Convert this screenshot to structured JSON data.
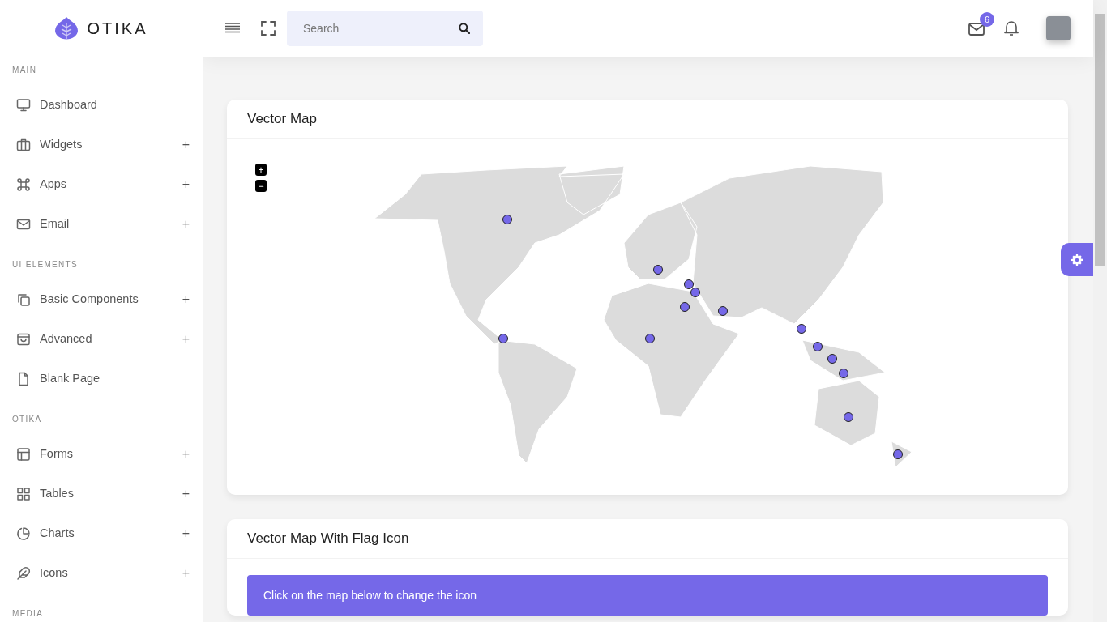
{
  "brand": {
    "name": "OTIKA"
  },
  "sidebar": {
    "sections": [
      {
        "heading": "MAIN",
        "items": [
          {
            "label": "Dashboard"
          },
          {
            "label": "Widgets",
            "toggle": "+"
          },
          {
            "label": "Apps",
            "toggle": "+"
          },
          {
            "label": "Email",
            "toggle": "+"
          }
        ]
      },
      {
        "heading": "UI ELEMENTS",
        "items": [
          {
            "label": "Basic Components",
            "toggle": "+"
          },
          {
            "label": "Advanced",
            "toggle": "+"
          },
          {
            "label": "Blank Page"
          }
        ]
      },
      {
        "heading": "OTIKA",
        "items": [
          {
            "label": "Forms",
            "toggle": "+"
          },
          {
            "label": "Tables",
            "toggle": "+"
          },
          {
            "label": "Charts",
            "toggle": "+"
          },
          {
            "label": "Icons",
            "toggle": "+"
          }
        ]
      },
      {
        "heading": "MEDIA"
      }
    ]
  },
  "header": {
    "search": {
      "placeholder": "Search"
    },
    "mail_badge": "6"
  },
  "cards": [
    {
      "kind": "map",
      "title": "Vector Map",
      "zoom_in": "+",
      "zoom_out": "−"
    },
    {
      "kind": "alert",
      "title": "Vector Map With Flag Icon",
      "alert": "Click on the map below to change the icon"
    }
  ]
}
